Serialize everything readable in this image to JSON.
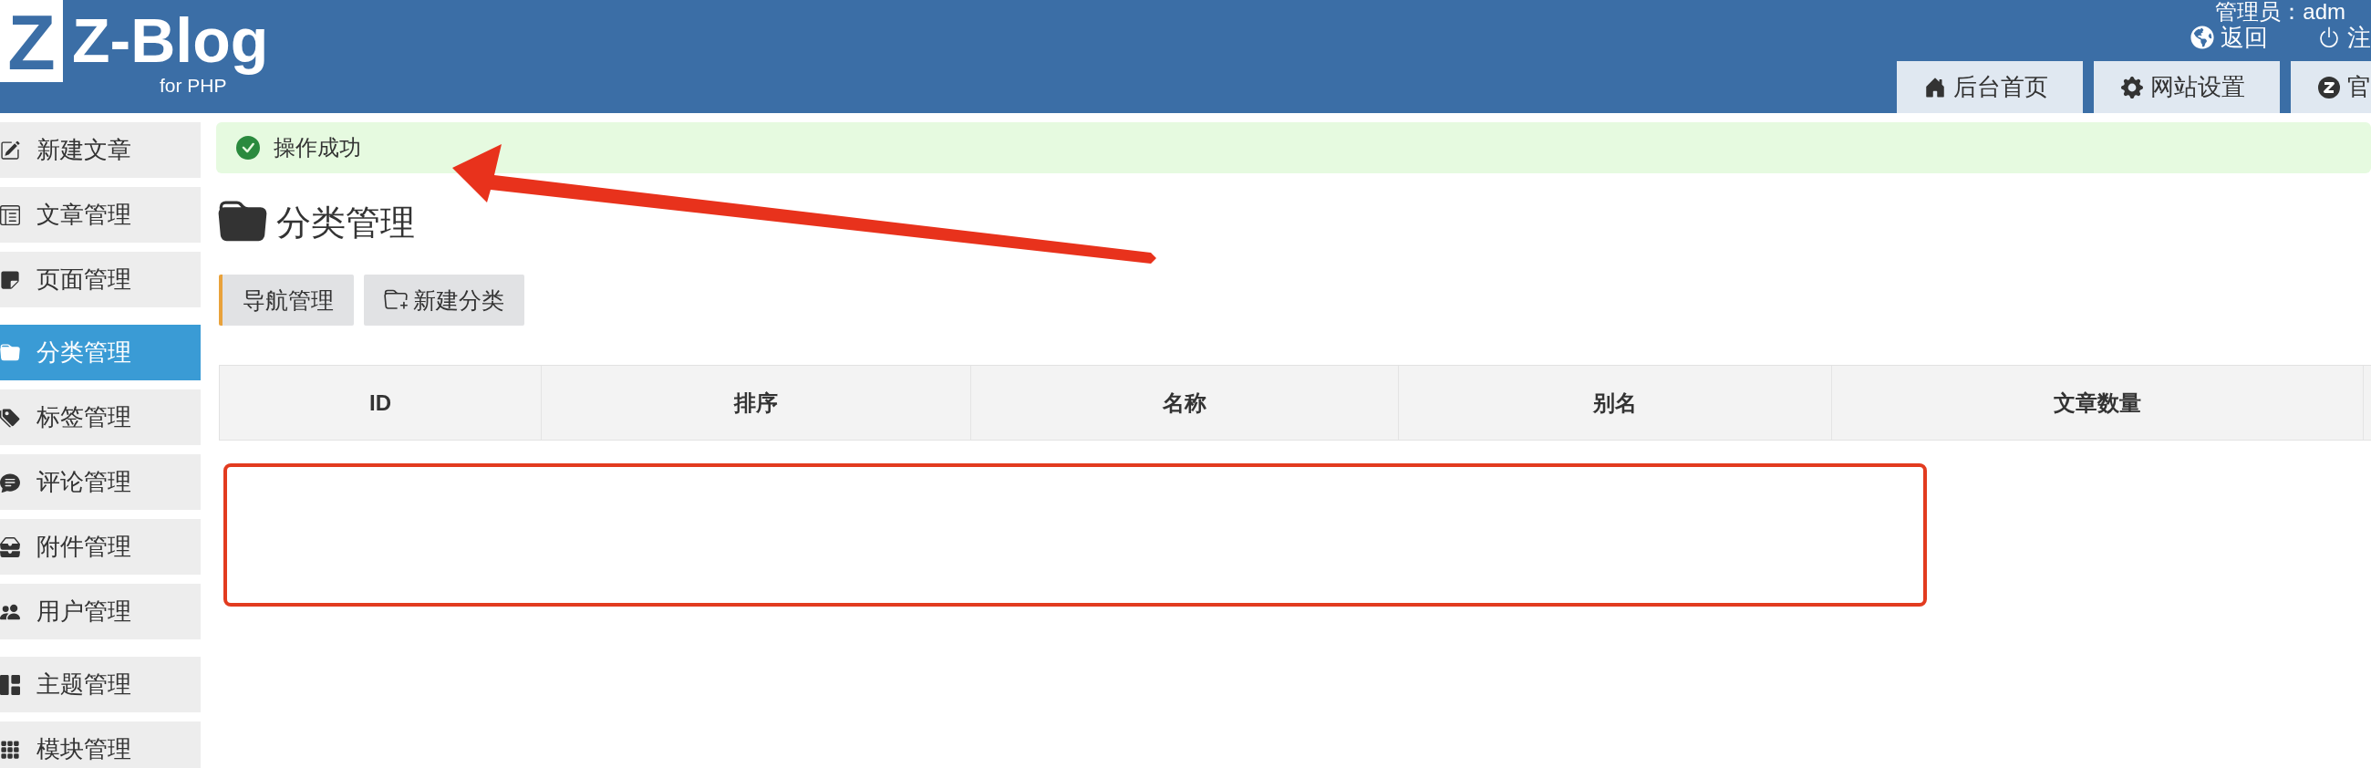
{
  "header": {
    "logo": {
      "mark": "Z",
      "name": "Z-Blog",
      "tagline": "for PHP"
    },
    "user": "管理员：adm",
    "links": [
      "返回",
      "注"
    ],
    "tabs": [
      "后台首页",
      "网站设置",
      "官"
    ]
  },
  "sidebar": {
    "groups": [
      {
        "items": [
          {
            "label": "新建文章",
            "selected": false
          },
          {
            "label": "文章管理",
            "selected": false
          },
          {
            "label": "页面管理",
            "selected": false
          }
        ]
      },
      {
        "items": [
          {
            "label": "分类管理",
            "selected": true
          },
          {
            "label": "标签管理",
            "selected": false
          },
          {
            "label": "评论管理",
            "selected": false
          },
          {
            "label": "附件管理",
            "selected": false
          },
          {
            "label": "用户管理",
            "selected": false
          }
        ]
      },
      {
        "items": [
          {
            "label": "主题管理",
            "selected": false
          },
          {
            "label": "模块管理",
            "selected": false
          }
        ]
      }
    ]
  },
  "notice": {
    "kind": "success",
    "text": "操作成功"
  },
  "title": "分类管理",
  "actions": [
    {
      "label": "导航管理",
      "selected": true
    },
    {
      "label": "新建分类",
      "selected": false
    }
  ],
  "table": {
    "columns": [
      "ID",
      "排序",
      "名称",
      "别名",
      "文章数量"
    ]
  },
  "annotations": {
    "arrow": true,
    "frame": true
  }
}
